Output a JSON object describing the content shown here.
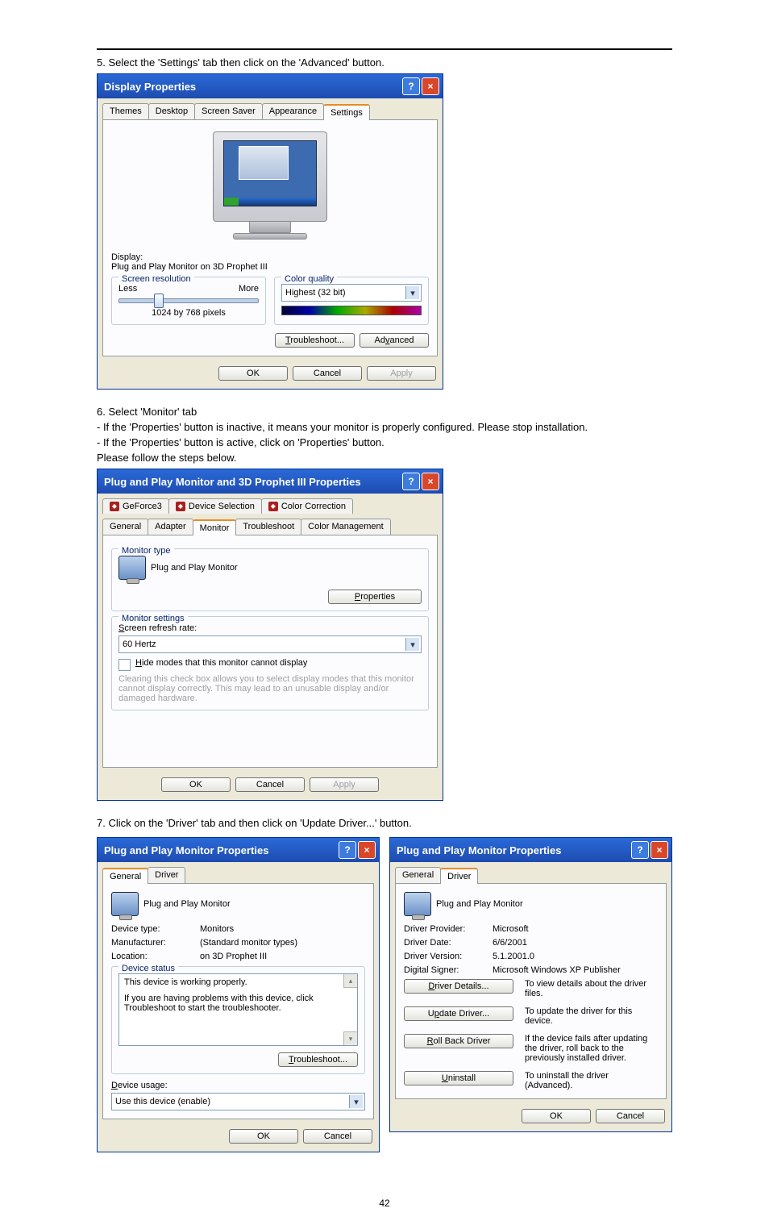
{
  "step5": "5. Select the 'Settings' tab then click on the 'Advanced' button.",
  "step6a": "6. Select 'Monitor' tab",
  "step6b": "- If the 'Properties' button is inactive, it means your monitor is properly configured. Please stop installation.",
  "step6c": "- If the 'Properties' button is active, click on 'Properties' button.",
  "step6d": "Please follow the steps below.",
  "step7": "7. Click on the 'Driver' tab and then click on 'Update Driver...' button.",
  "page_number": "42",
  "dlg1": {
    "title": "Display Properties",
    "tabs": [
      "Themes",
      "Desktop",
      "Screen Saver",
      "Appearance",
      "Settings"
    ],
    "display_label": "Display:",
    "display_value": "Plug and Play Monitor on 3D Prophet III",
    "screen_res_legend": "Screen resolution",
    "less": "Less",
    "more": "More",
    "res_value": "1024 by 768 pixels",
    "color_legend": "Color quality",
    "color_value": "Highest (32 bit)",
    "troubleshoot": "Troubleshoot...",
    "advanced": "Advanced",
    "ok": "OK",
    "cancel": "Cancel",
    "apply": "Apply"
  },
  "dlg2": {
    "title": "Plug and Play Monitor and 3D Prophet III Properties",
    "tabs_top": [
      "GeForce3",
      "Device Selection",
      "Color Correction"
    ],
    "tabs_bottom": [
      "General",
      "Adapter",
      "Monitor",
      "Troubleshoot",
      "Color Management"
    ],
    "montype_legend": "Monitor type",
    "monname": "Plug and Play Monitor",
    "properties": "Properties",
    "monset_legend": "Monitor settings",
    "refresh_label": "Screen refresh rate:",
    "refresh_value": "60 Hertz",
    "hide_label": "Hide modes that this monitor cannot display",
    "hide_note": "Clearing this check box allows you to select display modes that this monitor cannot display correctly. This may lead to an unusable display and/or damaged hardware.",
    "ok": "OK",
    "cancel": "Cancel",
    "apply": "Apply"
  },
  "dlg3": {
    "title": "Plug and Play Monitor Properties",
    "tabs": [
      "General",
      "Driver"
    ],
    "monname": "Plug and Play Monitor",
    "dev_type_l": "Device type:",
    "dev_type_v": "Monitors",
    "manu_l": "Manufacturer:",
    "manu_v": "(Standard monitor types)",
    "loc_l": "Location:",
    "loc_v": "on 3D Prophet III",
    "status_legend": "Device status",
    "status_text": "This device is working properly.",
    "status_text2": "If you are having problems with this device, click Troubleshoot to start the troubleshooter.",
    "troubleshoot": "Troubleshoot...",
    "usage_label": "Device usage:",
    "usage_value": "Use this device (enable)",
    "ok": "OK",
    "cancel": "Cancel"
  },
  "dlg4": {
    "title": "Plug and Play Monitor Properties",
    "tabs": [
      "General",
      "Driver"
    ],
    "monname": "Plug and Play Monitor",
    "prov_l": "Driver Provider:",
    "prov_v": "Microsoft",
    "date_l": "Driver Date:",
    "date_v": "6/6/2001",
    "ver_l": "Driver Version:",
    "ver_v": "5.1.2001.0",
    "sig_l": "Digital Signer:",
    "sig_v": "Microsoft Windows XP Publisher",
    "btn_details": "Driver Details...",
    "btn_details_d": "To view details about the driver files.",
    "btn_update": "Update Driver...",
    "btn_update_d": "To update the driver for this device.",
    "btn_rollback": "Roll Back Driver",
    "btn_rollback_d": "If the device fails after updating the driver, roll back to the previously installed driver.",
    "btn_uninstall": "Uninstall",
    "btn_uninstall_d": "To uninstall the driver (Advanced).",
    "ok": "OK",
    "cancel": "Cancel"
  }
}
